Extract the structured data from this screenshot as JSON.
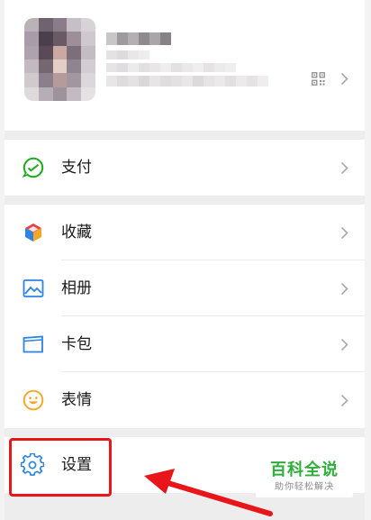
{
  "menu": {
    "items": [
      {
        "label": "支付",
        "icon": "wallet-icon"
      },
      {
        "label": "收藏",
        "icon": "favorites-cube-icon"
      },
      {
        "label": "相册",
        "icon": "photo-album-icon"
      },
      {
        "label": "卡包",
        "icon": "card-wallet-icon"
      },
      {
        "label": "表情",
        "icon": "sticker-smile-icon"
      },
      {
        "label": "设置",
        "icon": "gear-icon"
      }
    ]
  },
  "watermark": {
    "title": "百科全说",
    "subtitle": "助你轻松解决"
  },
  "colors": {
    "pay_green": "#1aad19",
    "icon_blue": "#2b84e6",
    "sticker_yellow": "#f5a623",
    "highlight_red": "#e8161b",
    "watermark_green": "#2fae3a"
  }
}
